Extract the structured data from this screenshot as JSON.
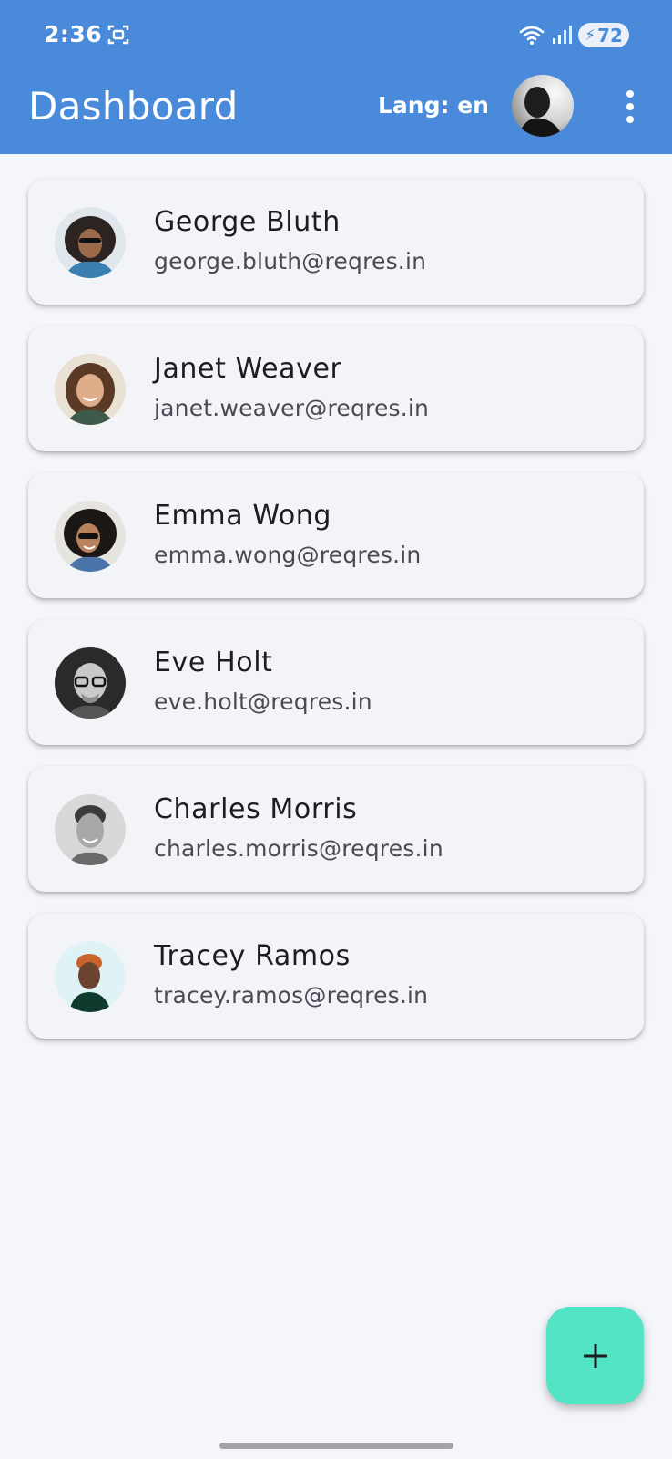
{
  "status_bar": {
    "time": "2:36",
    "battery": "72"
  },
  "appbar": {
    "title": "Dashboard",
    "lang_label": "Lang: en"
  },
  "users": [
    {
      "name": "George Bluth",
      "email": "george.bluth@reqres.in"
    },
    {
      "name": "Janet Weaver",
      "email": "janet.weaver@reqres.in"
    },
    {
      "name": "Emma Wong",
      "email": "emma.wong@reqres.in"
    },
    {
      "name": "Eve Holt",
      "email": "eve.holt@reqres.in"
    },
    {
      "name": "Charles Morris",
      "email": "charles.morris@reqres.in"
    },
    {
      "name": "Tracey Ramos",
      "email": "tracey.ramos@reqres.in"
    }
  ],
  "fab": {
    "icon": "add-icon"
  },
  "colors": {
    "appbar": "#4a8ada",
    "background": "#f4f6fb",
    "card": "#f3f4f8",
    "fab": "#52e4c4"
  }
}
